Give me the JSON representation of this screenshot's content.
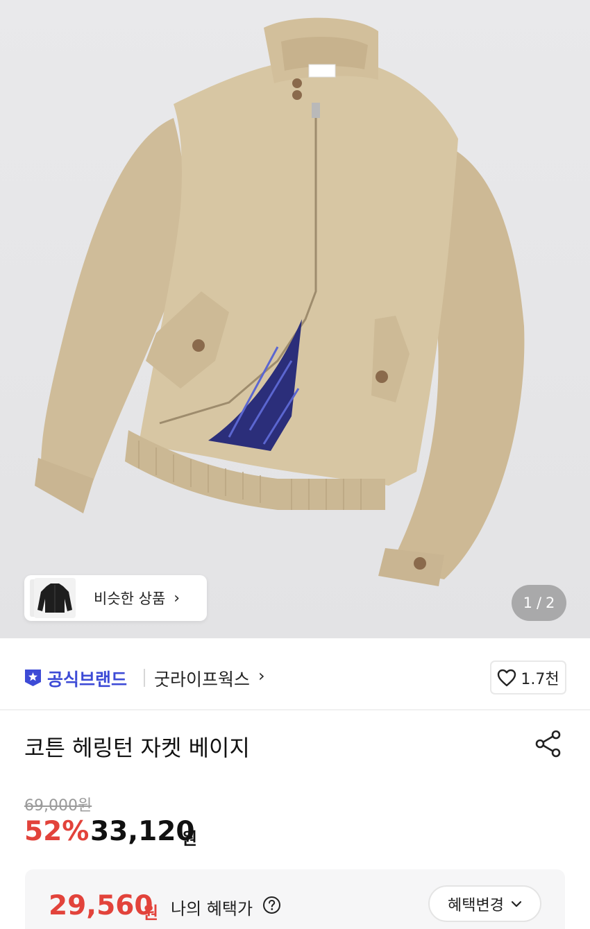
{
  "hero": {
    "similar_label": "비슷한 상품",
    "similar_arrow": "›",
    "pager_current": "1",
    "pager_sep": "/",
    "pager_total": "2"
  },
  "brand": {
    "official_label": "공식브랜드",
    "name": "굿라이프웍스",
    "arrow": "›",
    "like_count": "1.7천"
  },
  "product": {
    "title": "코튼 헤링턴 자켓 베이지"
  },
  "price": {
    "original": "69,000원",
    "discount_rate": "52%",
    "sale_amount": "33,120",
    "sale_unit": "원"
  },
  "benefit": {
    "amount": "29,560",
    "unit": "원",
    "label": "나의 혜택가",
    "change_label": "혜택변경",
    "change_arrow": "⌄"
  },
  "colors": {
    "accent_red": "#e2433b",
    "brand_blue": "#3d4bd6",
    "jacket_beige": "#d4c29f"
  }
}
